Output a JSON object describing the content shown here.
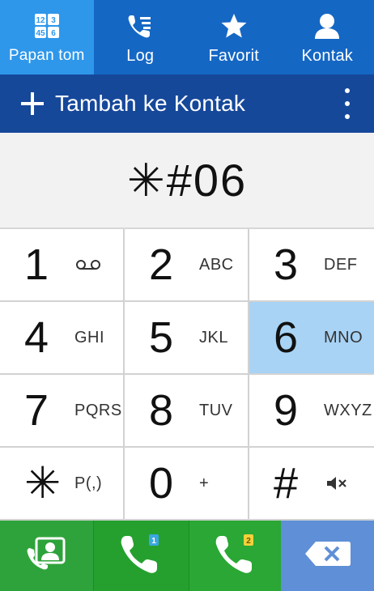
{
  "tabs": [
    {
      "label": "Papan tom",
      "icon": "keypad-icon",
      "active": true
    },
    {
      "label": "Log",
      "icon": "call-log-icon",
      "active": false
    },
    {
      "label": "Favorit",
      "icon": "star-icon",
      "active": false
    },
    {
      "label": "Kontak",
      "icon": "person-icon",
      "active": false
    }
  ],
  "add_bar": {
    "label": "Tambah ke Kontak",
    "icon": "plus-icon",
    "menu_icon": "more-vertical-icon"
  },
  "display": {
    "number": "✳#06"
  },
  "keys": [
    {
      "digit": "1",
      "letters": "",
      "sub_icon": "voicemail-icon"
    },
    {
      "digit": "2",
      "letters": "ABC"
    },
    {
      "digit": "3",
      "letters": "DEF"
    },
    {
      "digit": "4",
      "letters": "GHI"
    },
    {
      "digit": "5",
      "letters": "JKL"
    },
    {
      "digit": "6",
      "letters": "MNO",
      "highlighted": true
    },
    {
      "digit": "7",
      "letters": "PQRS"
    },
    {
      "digit": "8",
      "letters": "TUV"
    },
    {
      "digit": "9",
      "letters": "WXYZ"
    },
    {
      "digit": "✳",
      "letters": "P(,)"
    },
    {
      "digit": "0",
      "letters": "+"
    },
    {
      "digit": "#",
      "letters": "",
      "sub_icon": "mute-icon"
    }
  ],
  "actions": [
    {
      "icon": "contacts-card-icon"
    },
    {
      "icon": "call-sim1-icon"
    },
    {
      "icon": "call-sim2-icon"
    },
    {
      "icon": "backspace-icon"
    }
  ],
  "colors": {
    "tab_bar": "#1567c4",
    "tab_active": "#2e97ea",
    "add_bar": "#16489a",
    "key_highlight": "#a8d3f5",
    "call_green": "#25a02f",
    "backspace_blue": "#5f8fd6"
  }
}
